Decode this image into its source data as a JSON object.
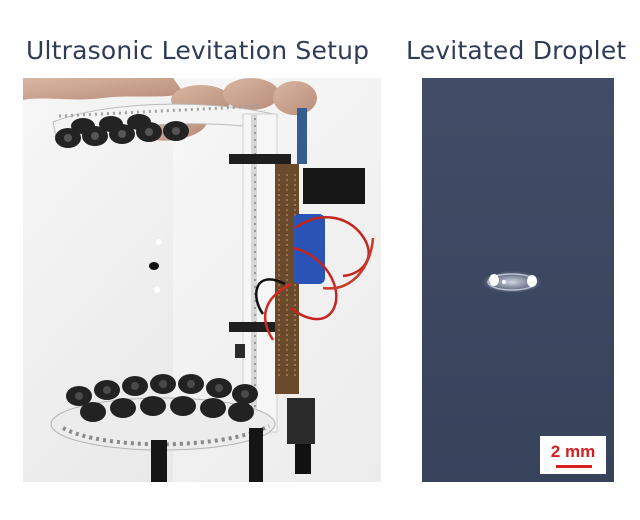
{
  "titles": {
    "left": "Ultrasonic Levitation Setup",
    "right": "Levitated Droplet"
  },
  "scale_bar": {
    "label": "2 mm"
  },
  "colors": {
    "title_text": "#2f3b57",
    "droplet_background": "#3b465f",
    "scale_bar": "#d61f1f"
  }
}
